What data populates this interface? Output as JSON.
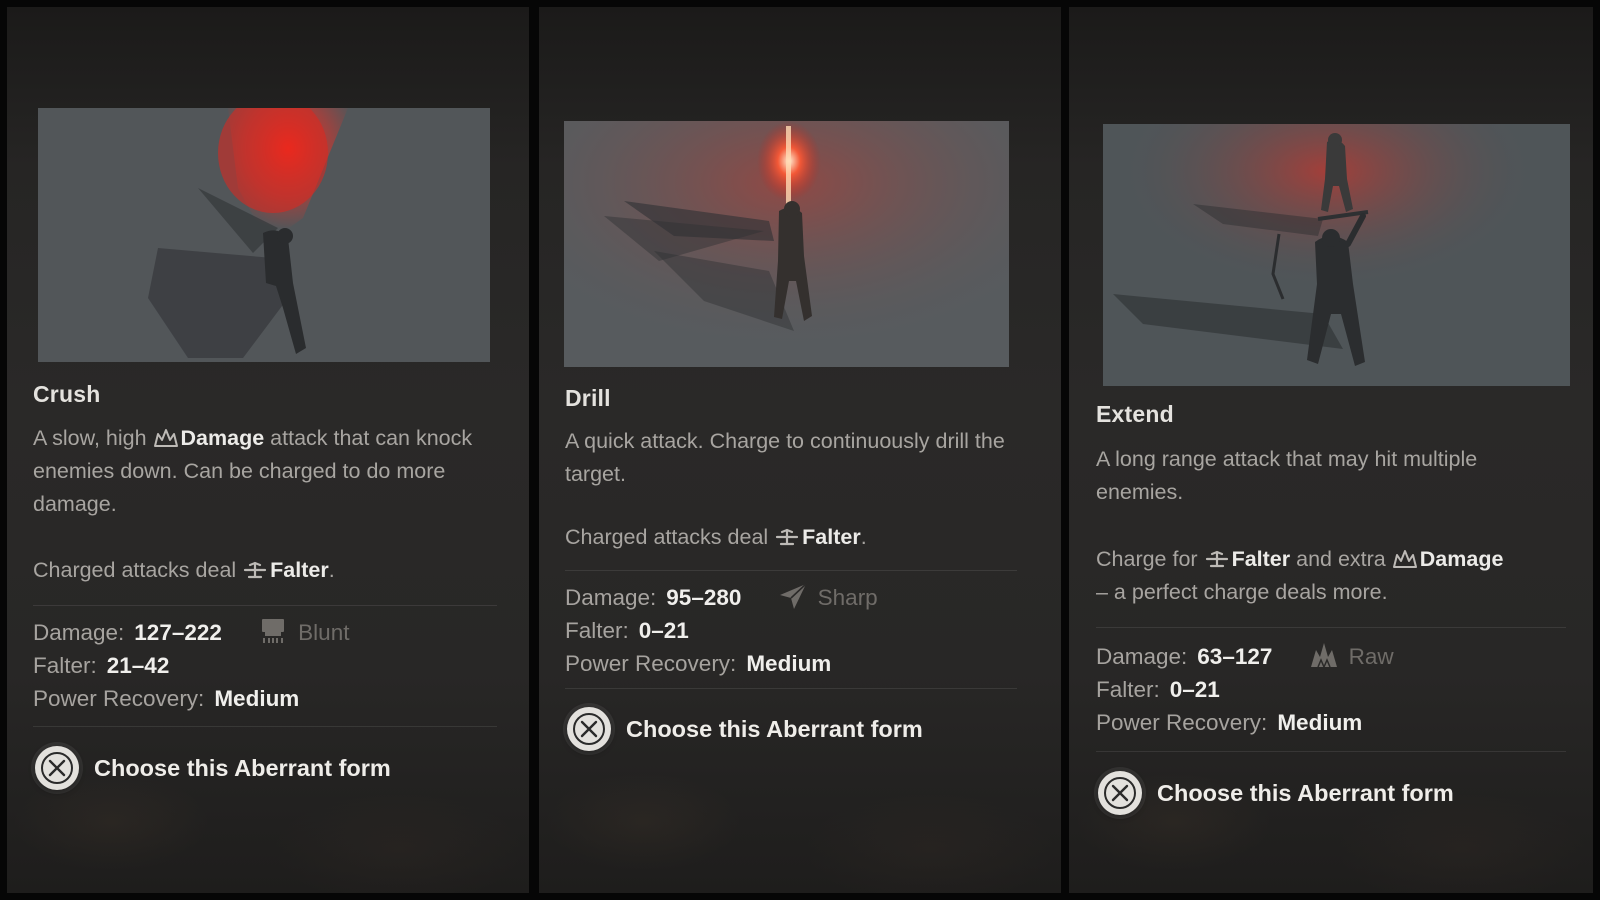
{
  "forms": [
    {
      "id": "crush",
      "title": "Crush",
      "description": {
        "part1": "A slow, high",
        "highlight": "Damage",
        "part2": "attack that can knock enemies down. Can be charged to do more damage."
      },
      "charged": {
        "prefix": "Charged attacks deal",
        "highlight": "Falter",
        "suffix": "."
      },
      "stats": {
        "damage_label": "Damage:",
        "damage_value": "127–222",
        "damage_type": "Blunt",
        "damage_type_icon": "blunt-icon",
        "falter_label": "Falter:",
        "falter_value": "21–42",
        "recovery_label": "Power Recovery:",
        "recovery_value": "Medium"
      },
      "choose_label": "Choose this Aberrant form",
      "choose_icon": "cross-button-icon"
    },
    {
      "id": "drill",
      "title": "Drill",
      "description": {
        "text": "A quick attack. Charge to continuously drill the target."
      },
      "charged": {
        "prefix": "Charged attacks deal",
        "highlight": "Falter",
        "suffix": "."
      },
      "stats": {
        "damage_label": "Damage:",
        "damage_value": "95–280",
        "damage_type": "Sharp",
        "damage_type_icon": "sharp-icon",
        "falter_label": "Falter:",
        "falter_value": "0–21",
        "recovery_label": "Power Recovery:",
        "recovery_value": "Medium"
      },
      "choose_label": "Choose this Aberrant form",
      "choose_icon": "cross-button-icon"
    },
    {
      "id": "extend",
      "title": "Extend",
      "description": {
        "text": "A long range attack that may hit multiple enemies."
      },
      "charged": {
        "prefix": "Charge for",
        "highlight1": "Falter",
        "middle": "and extra",
        "highlight2": "Damage",
        "line2": "– a perfect charge deals more."
      },
      "stats": {
        "damage_label": "Damage:",
        "damage_value": "63–127",
        "damage_type": "Raw",
        "damage_type_icon": "raw-icon",
        "falter_label": "Falter:",
        "falter_value": "0–21",
        "recovery_label": "Power Recovery:",
        "recovery_value": "Medium"
      },
      "choose_label": "Choose this Aberrant form",
      "choose_icon": "cross-button-icon"
    }
  ],
  "colors": {
    "panel_bg": "#2a2928",
    "title": "#e4e2de",
    "body_text": "#a8a5a1",
    "highlight_text": "#ecebe8",
    "stat_value": "#f0efec",
    "type_text": "#6f6c68",
    "accent_red": "#d8342c"
  }
}
